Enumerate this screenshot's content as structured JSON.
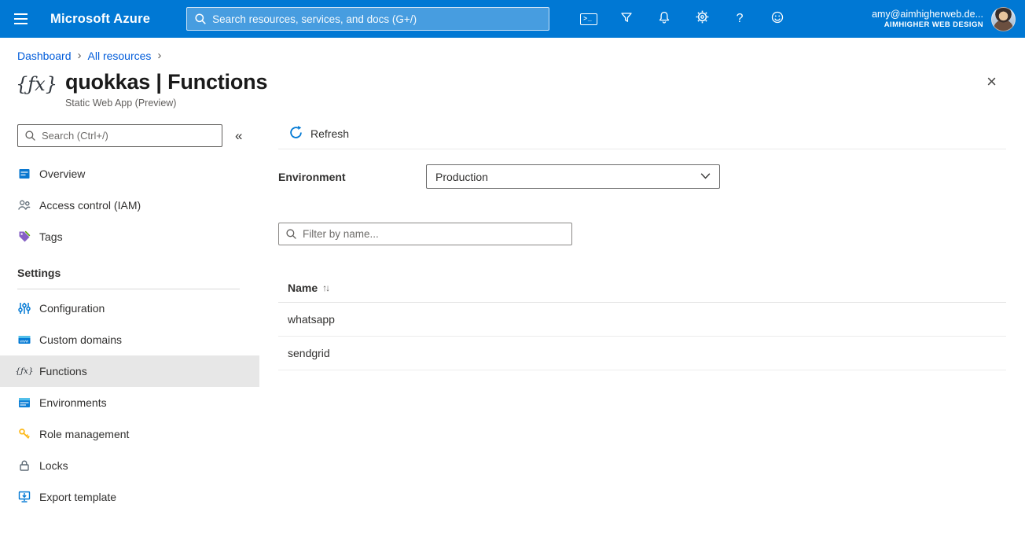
{
  "colors": {
    "topbar_bg": "#0078d4",
    "accent": "#0078d4",
    "link": "#015cda",
    "selected_item_bg": "#e7e7e7",
    "key_yellow": "#fdb714",
    "tag_purple": "#8661c5"
  },
  "icons": {
    "fx_glyph": "{ƒx}",
    "close_glyph": "×",
    "collapse_glyph": "«",
    "sort_glyph": "↑↓",
    "breadcrumb_separator": "›",
    "cloudshell_glyph": ">_",
    "help_glyph": "?"
  },
  "topbar": {
    "brand": "Microsoft Azure",
    "search_placeholder": "Search resources, services, and docs (G+/)",
    "account_email": "amy@aimhigherweb.de...",
    "account_tenant": "AIMHIGHER WEB DESIGN"
  },
  "breadcrumb": {
    "items": [
      {
        "label": "Dashboard"
      },
      {
        "label": "All resources"
      }
    ]
  },
  "page": {
    "title": "quokkas | Functions",
    "subtitle": "Static Web App (Preview)"
  },
  "sidebar": {
    "search_placeholder": "Search (Ctrl+/)",
    "items": [
      {
        "label": "Overview"
      },
      {
        "label": "Access control (IAM)"
      },
      {
        "label": "Tags"
      }
    ],
    "section": {
      "header": "Settings",
      "items": [
        {
          "label": "Configuration"
        },
        {
          "label": "Custom domains"
        },
        {
          "label": "Functions",
          "selected": true
        },
        {
          "label": "Environments"
        },
        {
          "label": "Role management"
        },
        {
          "label": "Locks"
        },
        {
          "label": "Export template"
        }
      ]
    }
  },
  "main": {
    "refresh_label": "Refresh",
    "environment_label": "Environment",
    "environment_value": "Production",
    "filter_placeholder": "Filter by name...",
    "table": {
      "columns": [
        {
          "label": "Name"
        }
      ],
      "rows": [
        {
          "name": "whatsapp"
        },
        {
          "name": "sendgrid"
        }
      ]
    }
  }
}
